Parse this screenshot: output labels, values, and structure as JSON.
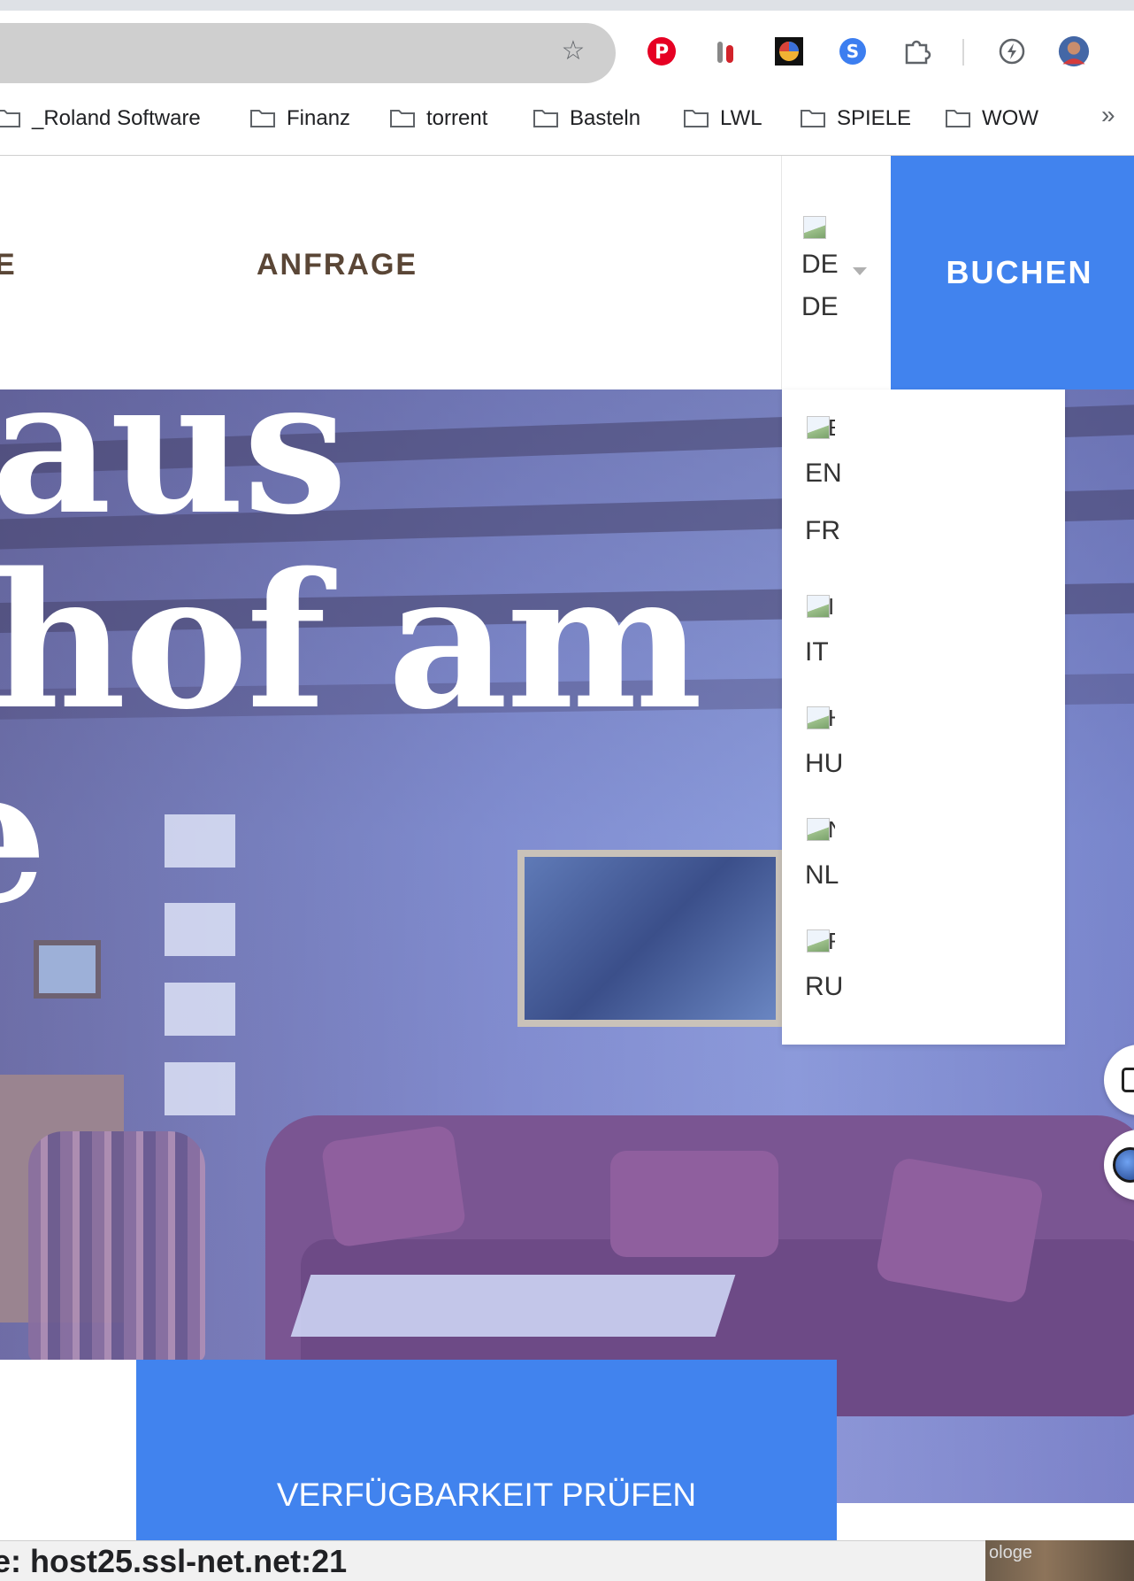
{
  "browser": {
    "bookmarks": [
      "_Roland Software",
      "Finanz",
      "torrent",
      "Basteln",
      "LWL",
      "SPIELE",
      "WOW"
    ],
    "more_bookmarks": "»",
    "icons": [
      "star-icon",
      "pinterest-icon",
      "extension-icon",
      "extension-icon",
      "extension-icon",
      "puzzle-icon",
      "lightning-icon",
      "avatar"
    ]
  },
  "header": {
    "nav": {
      "left_partial": "E",
      "inquiry": "ANFRAGE"
    },
    "language": {
      "flag_alt": "DE",
      "current": "DE"
    },
    "book_label": "BUCHEN"
  },
  "hero": {
    "title_line1": "aus",
    "title_line2": "hof am",
    "title_line3": "e"
  },
  "language_dropdown": {
    "items": [
      {
        "alt": "E",
        "code": "EN"
      },
      {
        "alt": "",
        "code": "FR"
      },
      {
        "alt": "I",
        "code": "IT"
      },
      {
        "alt": "H",
        "code": "HU"
      },
      {
        "alt": "N",
        "code": "NL"
      },
      {
        "alt": "R",
        "code": "RU"
      }
    ]
  },
  "booking": {
    "check_label": "VERFÜGBARKEIT PRÜFEN"
  },
  "status": {
    "text": "e: host25.ssl-net.net:21",
    "corner_text": "ologe"
  },
  "colors": {
    "accent": "#4183ee",
    "nav_text": "#5a4636"
  }
}
